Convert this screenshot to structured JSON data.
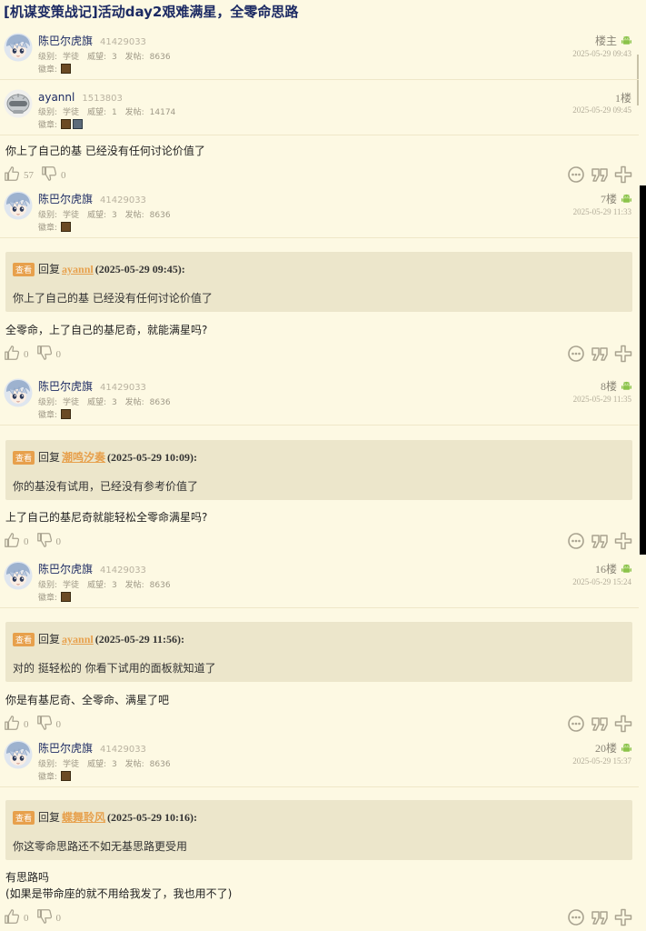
{
  "thread": {
    "title": "[机谋变策战记]活动day2艰难满星，全零命思路"
  },
  "labels": {
    "level": "级别:",
    "prestige": "威望:",
    "posts": "发帖:",
    "medal": "徽章:",
    "quote_tag": "查看",
    "reply": "回复"
  },
  "posts": [
    {
      "user": "陈巴尔虎旗",
      "uid": "41429033",
      "level": "学徒",
      "prestige": "3",
      "post_count": "8636",
      "floor": "楼主",
      "time": "2025-05-29 09:43",
      "platform_icon": "android-icon"
    },
    {
      "user": "ayannl",
      "uid": "1513803",
      "level": "学徒",
      "prestige": "1",
      "post_count": "14174",
      "floor": "1楼",
      "time": "2025-05-29 09:45",
      "content": "你上了自己的基 已经没有任何讨论价值了",
      "likes": "57",
      "dislikes": "0"
    },
    {
      "user": "陈巴尔虎旗",
      "uid": "41429033",
      "level": "学徒",
      "prestige": "3",
      "post_count": "8636",
      "floor": "7楼",
      "time": "2025-05-29 11:33",
      "quote": {
        "user": "ayannl",
        "time": "(2025-05-29 09:45):",
        "text": "你上了自己的基 已经没有任何讨论价值了"
      },
      "content": "全零命，上了自己的基尼奇，就能满星吗?",
      "likes": "0",
      "dislikes": "0"
    },
    {
      "user": "陈巴尔虎旗",
      "uid": "41429033",
      "level": "学徒",
      "prestige": "3",
      "post_count": "8636",
      "floor": "8楼",
      "time": "2025-05-29 11:35",
      "quote": {
        "user": "潮鸣汐奏",
        "time": "(2025-05-29 10:09):",
        "text": "你的基没有试用，已经没有参考价值了"
      },
      "content": "上了自己的基尼奇就能轻松全零命满星吗?",
      "likes": "0",
      "dislikes": "0"
    },
    {
      "user": "陈巴尔虎旗",
      "uid": "41429033",
      "level": "学徒",
      "prestige": "3",
      "post_count": "8636",
      "floor": "16楼",
      "time": "2025-05-29 15:24",
      "quote": {
        "user": "ayannl",
        "time": "(2025-05-29 11:56):",
        "text": "对的 挺轻松的 你看下试用的面板就知道了"
      },
      "content": "你是有基尼奇、全零命、满星了吧",
      "likes": "0",
      "dislikes": "0"
    },
    {
      "user": "陈巴尔虎旗",
      "uid": "41429033",
      "level": "学徒",
      "prestige": "3",
      "post_count": "8636",
      "floor": "20楼",
      "time": "2025-05-29 15:37",
      "quote": {
        "user": "蝶舞聆风",
        "time": "(2025-05-29 10:16):",
        "text": "你这零命思路还不如无基思路更受用"
      },
      "content_line1": "有思路吗",
      "content_line2": "(如果是带命座的就不用给我发了，我也用不了)",
      "likes": "0",
      "dislikes": "0"
    }
  ],
  "colors": {
    "background": "#fdf9e3",
    "title": "#1c2a63",
    "quote_bg": "#ece6cb",
    "accent": "#e7a04c",
    "android": "#8bc34a"
  }
}
